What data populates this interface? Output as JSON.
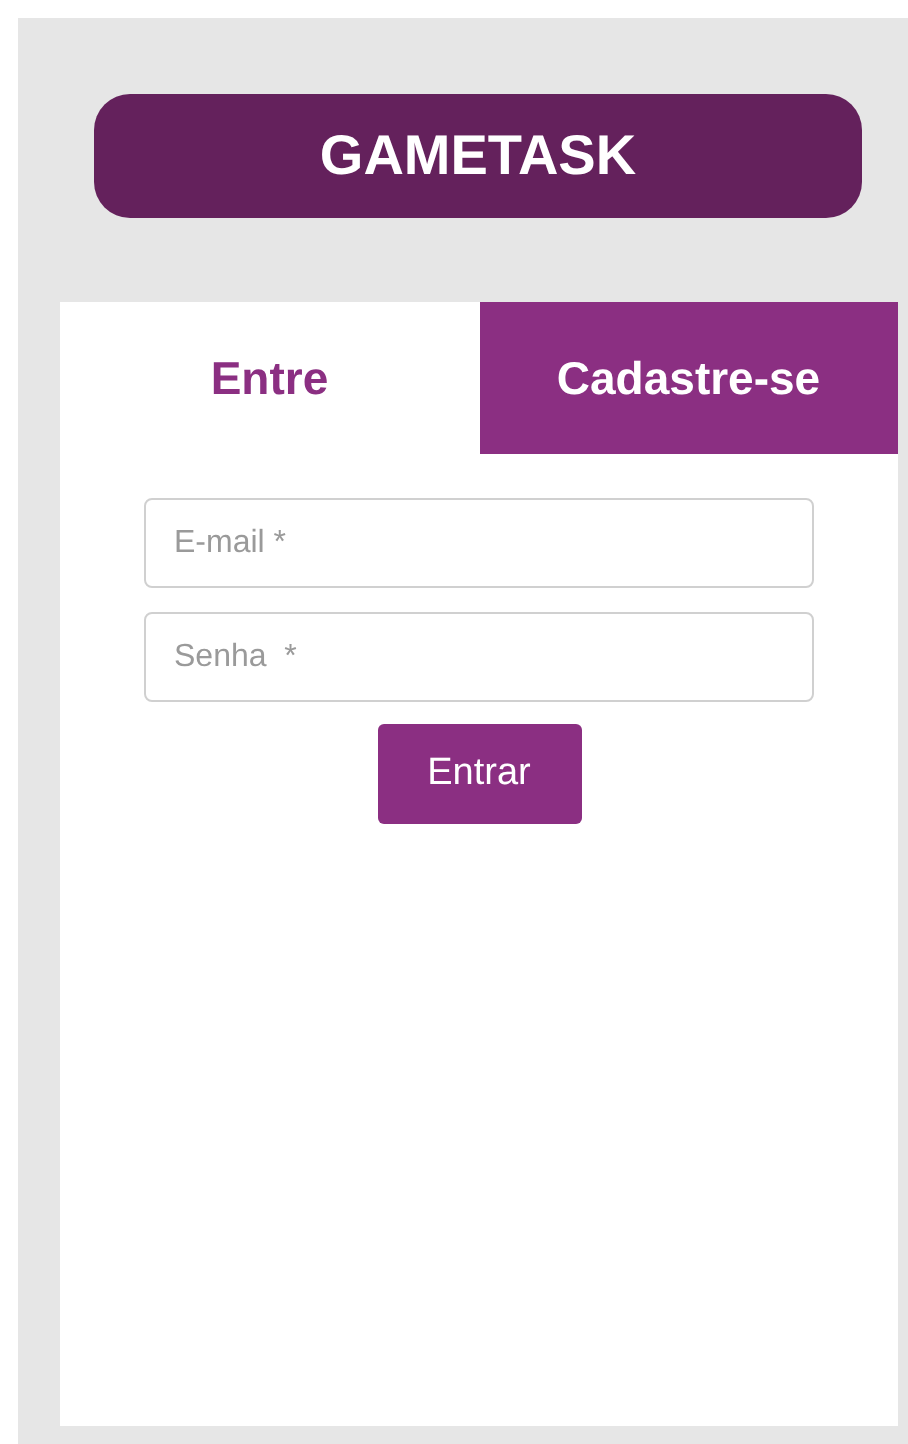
{
  "header": {
    "title": "GAMETASK"
  },
  "tabs": [
    {
      "label": "Entre",
      "selected": true
    },
    {
      "label": "Cadastre-se",
      "selected": false
    }
  ],
  "fields": [
    {
      "placeholder": "E-mail *"
    },
    {
      "placeholder": "Senha  *"
    }
  ],
  "submit": {
    "label": "Entrar"
  }
}
